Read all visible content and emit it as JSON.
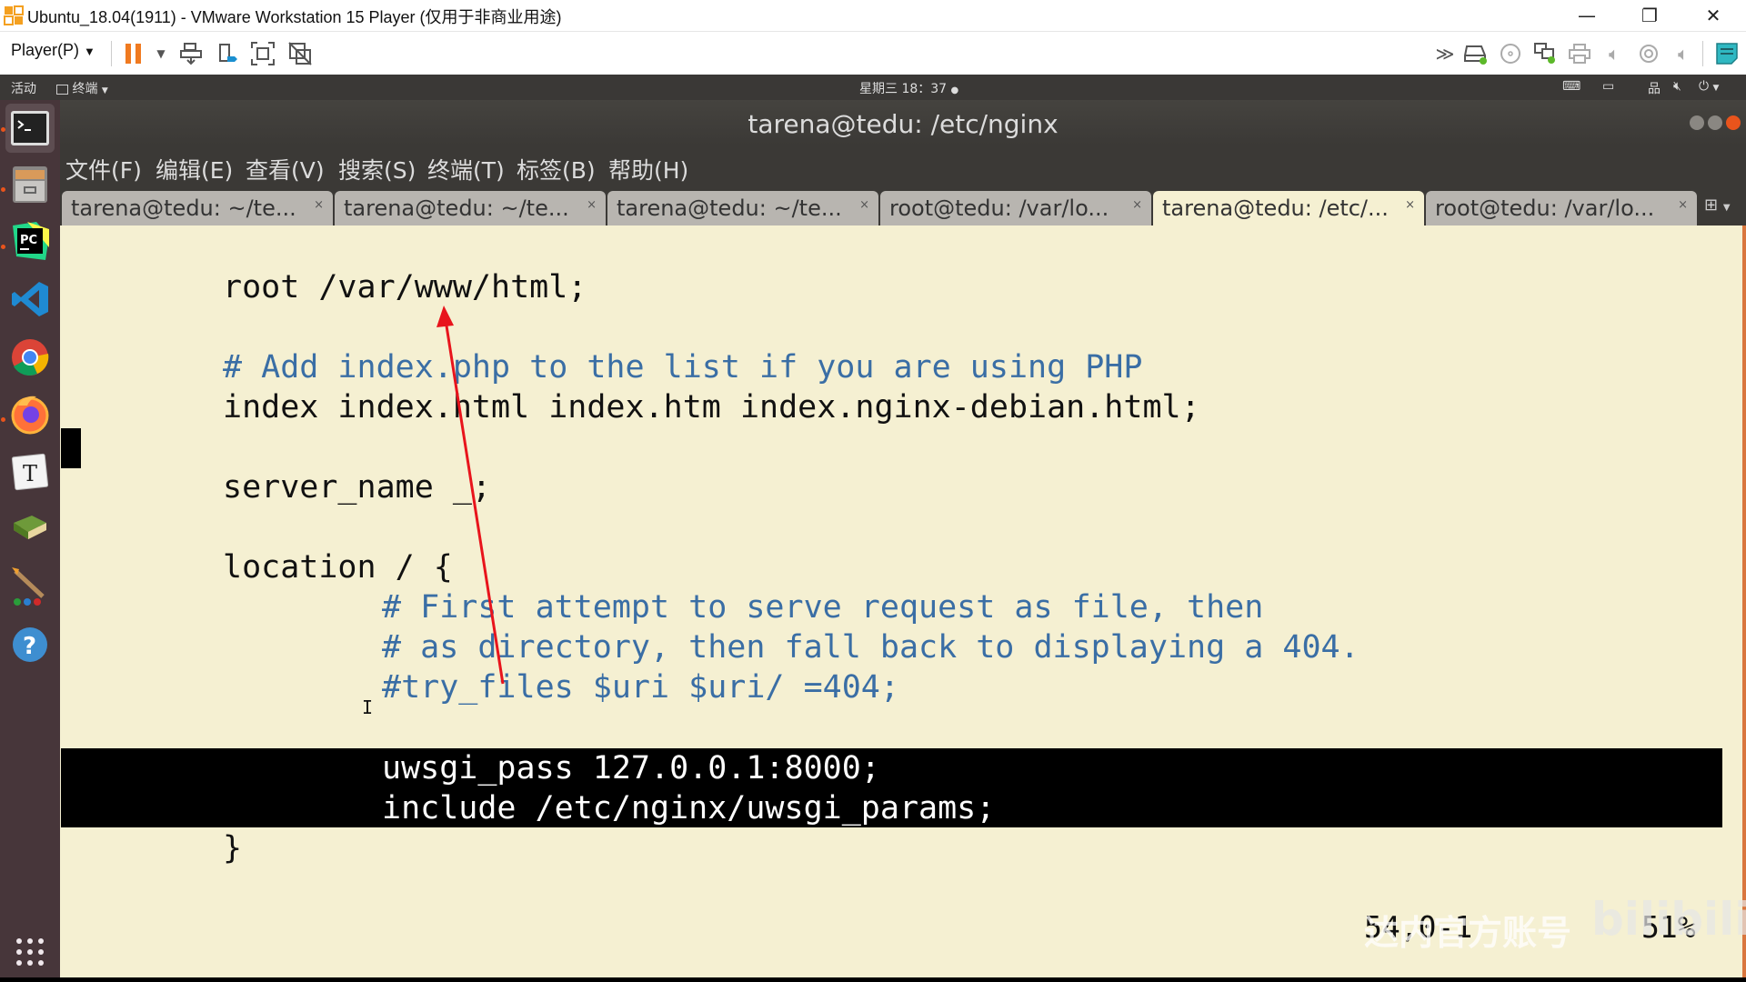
{
  "vmware": {
    "window_title": "Ubuntu_18.04(1911) - VMware Workstation 15 Player (仅用于非商业用途)",
    "minimize": "—",
    "restore": "❐",
    "close": "✕",
    "player_menu": "Player(P)",
    "toolbar_left": [
      "pause-icon",
      "dropdown-icon",
      "send-ctrl-alt-del-icon",
      "connect-device-icon",
      "full-screen-icon",
      "unity-icon"
    ],
    "toolbar_right": [
      "more-icon",
      "hard-disk-icon",
      "cd-icon",
      "network-adapter-icon",
      "printer-icon",
      "sound-icon",
      "camera-icon",
      "sound-card-icon",
      "message-log-icon"
    ]
  },
  "gnome": {
    "activities": "活动",
    "app_menu": "终端",
    "clock": "星期三 18：37",
    "tray": [
      "keyboard-icon",
      "input-method-icon",
      "network-icon",
      "volume-icon",
      "power-icon"
    ]
  },
  "dock": {
    "items": [
      {
        "name": "terminal",
        "running": true,
        "active": true
      },
      {
        "name": "files",
        "running": true
      },
      {
        "name": "pycharm",
        "running": true
      },
      {
        "name": "vscode",
        "running": false
      },
      {
        "name": "chrome",
        "running": false
      },
      {
        "name": "firefox",
        "running": true
      },
      {
        "name": "typora",
        "running": false
      },
      {
        "name": "books",
        "running": false
      },
      {
        "name": "paint",
        "running": false
      },
      {
        "name": "help",
        "running": false
      }
    ],
    "show_apps": "show-applications-icon"
  },
  "terminal": {
    "title": "tarena@tedu: /etc/nginx",
    "menu": [
      "文件(F)",
      "编辑(E)",
      "查看(V)",
      "搜索(S)",
      "终端(T)",
      "标签(B)",
      "帮助(H)"
    ],
    "tabs": [
      {
        "label": "tarena@tedu: ~/te...",
        "active": false
      },
      {
        "label": "tarena@tedu: ~/te...",
        "active": false
      },
      {
        "label": "tarena@tedu: ~/te...",
        "active": false
      },
      {
        "label": "root@tedu: /var/lo...",
        "active": false
      },
      {
        "label": "tarena@tedu: /etc/...",
        "active": true
      },
      {
        "label": "root@tedu: /var/lo...",
        "active": false
      }
    ],
    "tab_close": "×",
    "colors": {
      "background": "#f5f0d2",
      "comment": "#3a6ea5",
      "text": "#111111",
      "highlight_bg": "#000000"
    }
  },
  "editor": {
    "lines": [
      {
        "text": "root /var/www/html;",
        "type": "code",
        "indent": 1
      },
      {
        "text": "# Add index.php to the list if you are using PHP",
        "type": "comment",
        "indent": 1
      },
      {
        "text": "index index.html index.htm index.nginx-debian.html;",
        "type": "code",
        "indent": 1
      },
      {
        "text": "server_name _;",
        "type": "code",
        "indent": 1
      },
      {
        "text": "location / {",
        "type": "code",
        "indent": 1
      },
      {
        "text": "# First attempt to serve request as file, then",
        "type": "comment",
        "indent": 2
      },
      {
        "text": "# as directory, then fall back to displaying a 404.",
        "type": "comment",
        "indent": 2
      },
      {
        "text": "#try_files $uri $uri/ =404;",
        "type": "comment",
        "indent": 2
      },
      {
        "text": "uwsgi_pass 127.0.0.1:8000;",
        "type": "highlight",
        "indent": 2
      },
      {
        "text": "include /etc/nginx/uwsgi_params;",
        "type": "highlight",
        "indent": 2
      },
      {
        "text": "}",
        "type": "code",
        "indent": 1
      }
    ],
    "cursor_position": "54,0-1",
    "scroll_percent": "51%"
  },
  "overlay": {
    "watermark_text": "达内官方账号",
    "watermark_logo": "bilibili",
    "annotation_arrow_color": "#e8141c"
  }
}
